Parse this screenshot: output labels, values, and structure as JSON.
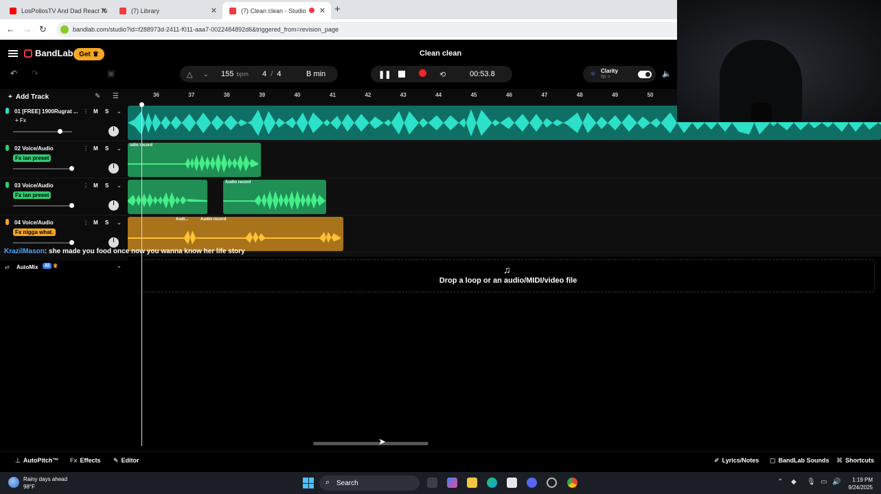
{
  "browser": {
    "tabs": [
      {
        "label": "LosPollosTV And Dad React To",
        "favicon_color": "#ff0000",
        "active": false
      },
      {
        "label": "(7) Library",
        "favicon_color": "#f5393f",
        "active": false
      },
      {
        "label": "(7) Clean clean - Studio",
        "favicon_color": "#f5393f",
        "active": true
      }
    ],
    "new_tab_icon": "+",
    "url": "bandlab.com/studio?id=f288973d-2411-f011-aaa7-0022484892d6&triggered_from=revision_page"
  },
  "studio": {
    "brand": "BandLab",
    "get_label": "Get",
    "project_title": "Clean clean",
    "tempo": "155",
    "tempo_unit": "bpm",
    "time_sig_num": "4",
    "time_sig_sep": "/",
    "time_sig_den": "4",
    "key": "B min",
    "time": "00:53.8",
    "clarity_label": "Clarity",
    "clarity_value": "50",
    "clarity_arrow": ">",
    "add_track": "Add Track",
    "bars": [
      "36",
      "37",
      "38",
      "39",
      "40",
      "41",
      "42",
      "43",
      "44",
      "45",
      "46",
      "47",
      "48",
      "49",
      "50"
    ],
    "tracks": [
      {
        "number": "01",
        "name": "[FREE] 1900Rugrat ...",
        "fx": "+ Fx",
        "fx_style": "plain",
        "volume": 0.8,
        "color": "#2de0c8",
        "mute": "M",
        "solo": "S"
      },
      {
        "number": "02",
        "name": "Voice/Audio",
        "fx": "Fx ian preset",
        "fx_style": "pill",
        "volume": 1.0,
        "color": "#2ecc71",
        "mute": "M",
        "solo": "S"
      },
      {
        "number": "03",
        "name": "Voice/Audio",
        "fx": "Fx ian preset",
        "fx_style": "pill",
        "volume": 1.0,
        "color": "#2ecc71",
        "mute": "M",
        "solo": "S"
      },
      {
        "number": "04",
        "name": "Voice/Audio",
        "fx": "Fx nigga what.",
        "fx_style": "pill",
        "volume": 1.0,
        "color": "#f5a623",
        "mute": "M",
        "solo": "S"
      }
    ],
    "clip_labels": {
      "track2": "udio record",
      "track3": "Audio record",
      "track4a": "Audi...",
      "track4b": "Audio record"
    },
    "chat": {
      "user": "KrazilMason",
      "message": ": she made you food once now you wanna know her life story"
    },
    "automix_label": "AutoMix",
    "automix_badge": "AI",
    "drop_text": "Drop a loop or an audio/MIDI/video file",
    "bottom": {
      "autopitch": "AutoPitch™",
      "effects": "Effects",
      "editor": "Editor",
      "lyrics": "Lyrics/Notes",
      "sounds": "BandLab Sounds",
      "shortcuts": "Shortcuts"
    }
  },
  "taskbar": {
    "weather_title": "Rainy days ahead",
    "weather_temp": "98°F",
    "search": "Search",
    "time": "1:19 PM",
    "date": "9/24/2025"
  }
}
